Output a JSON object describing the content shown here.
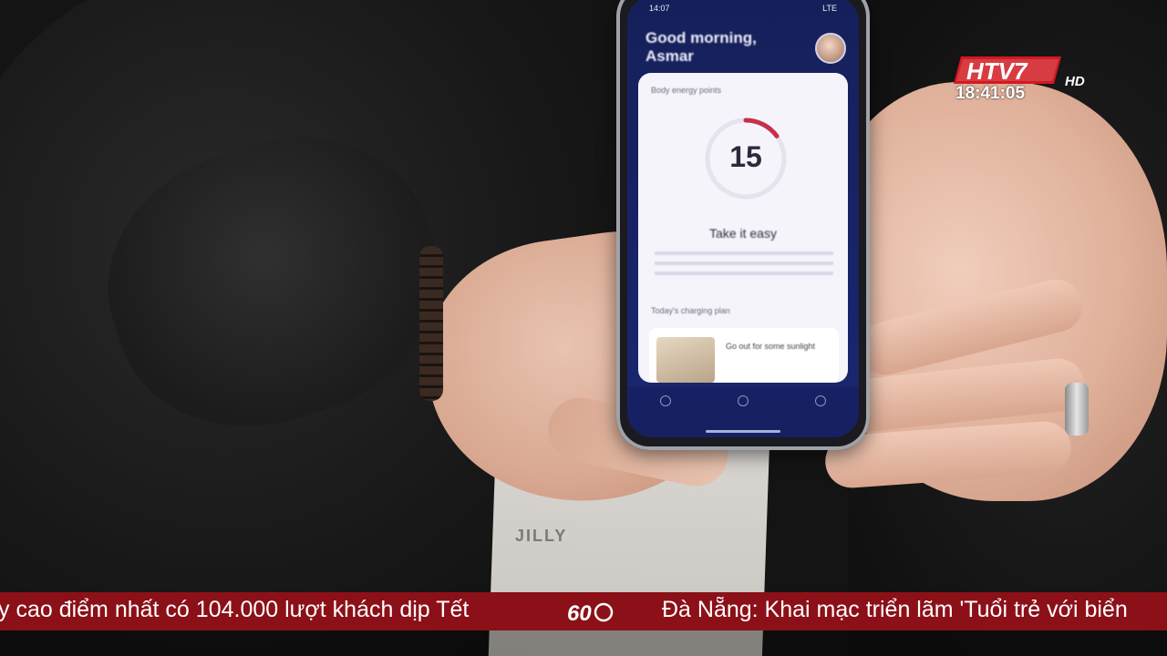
{
  "phone_app": {
    "status_time": "14:07",
    "status_right": "LTE",
    "greeting": "Good morning, Asmar",
    "card_label": "Body energy points",
    "energy_points": 15,
    "energy_progress": 0.15,
    "headline": "Take it easy",
    "section_label": "Today's charging plan",
    "recommendation": "Go out for some sunlight",
    "accent_color": "#c4324a"
  },
  "broadcast": {
    "channel_letters": "HTV7",
    "channel_suffix": "HD",
    "clock": "18:41:05",
    "ticker_left": "y cao điểm nhất có 104.000 lượt khách dịp Tết",
    "ticker_right": "Đà Nẵng: Khai mạc triển lãm 'Tuổi trẻ với biển",
    "badge_label": "60",
    "ticker_color": "#8c1018"
  },
  "lanyard": {
    "text": "JILLY"
  }
}
